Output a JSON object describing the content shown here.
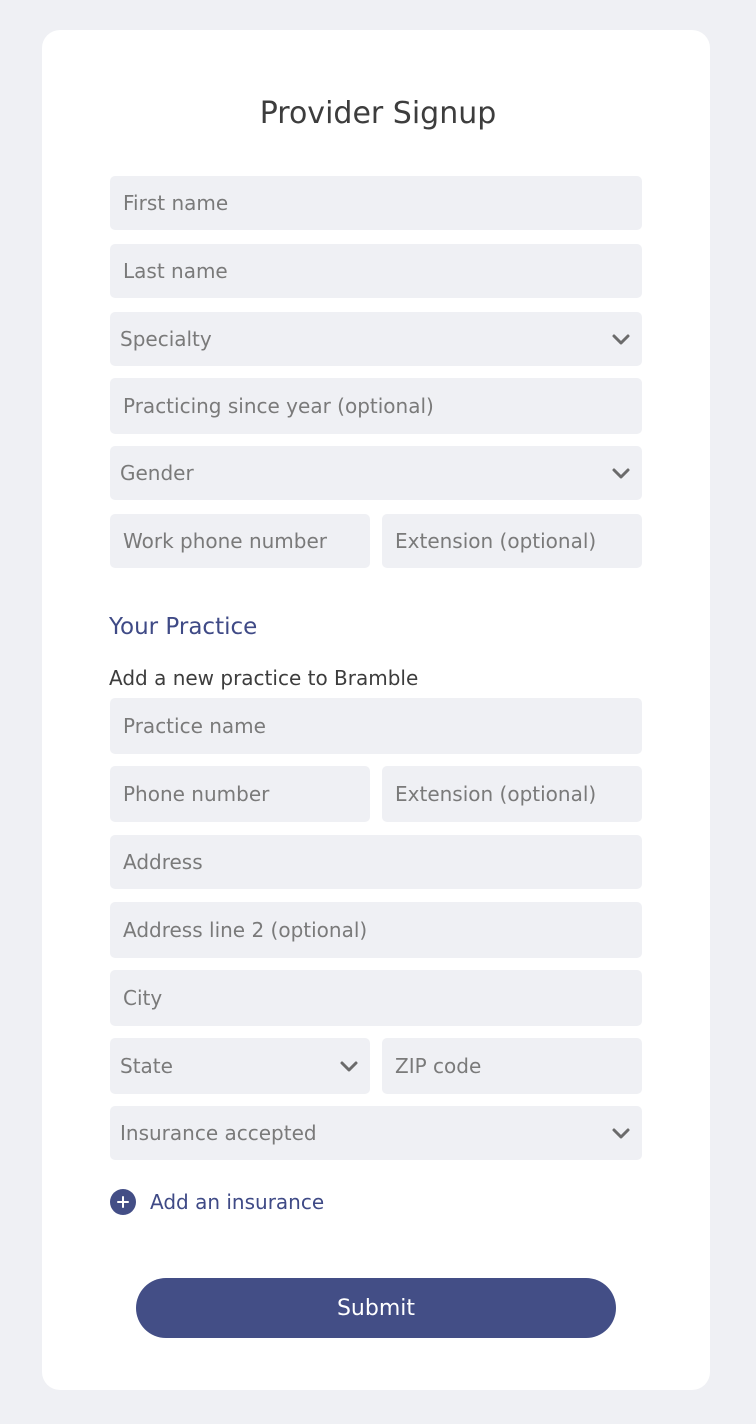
{
  "form": {
    "title": "Provider Signup",
    "fields": {
      "first_name": "First name",
      "last_name": "Last name",
      "specialty": "Specialty",
      "practicing_since": "Practicing since year (optional)",
      "gender": "Gender",
      "work_phone": "Work phone number",
      "work_extension": "Extension (optional)"
    }
  },
  "practice": {
    "section_title": "Your Practice",
    "subtitle": "Add a new practice to Bramble",
    "fields": {
      "practice_name": "Practice name",
      "phone": "Phone number",
      "extension": "Extension (optional)",
      "address": "Address",
      "address_line2": "Address line 2 (optional)",
      "city": "City",
      "state": "State",
      "zip": "ZIP code",
      "insurance": "Insurance accepted"
    },
    "add_insurance_label": "Add an insurance"
  },
  "actions": {
    "submit_label": "Submit"
  },
  "icons": {
    "chevron": "chevron-down-icon",
    "plus": "plus-icon"
  },
  "colors": {
    "accent": "#434e86",
    "page_background": "#eff0f4",
    "field_background": "#eff0f4"
  }
}
